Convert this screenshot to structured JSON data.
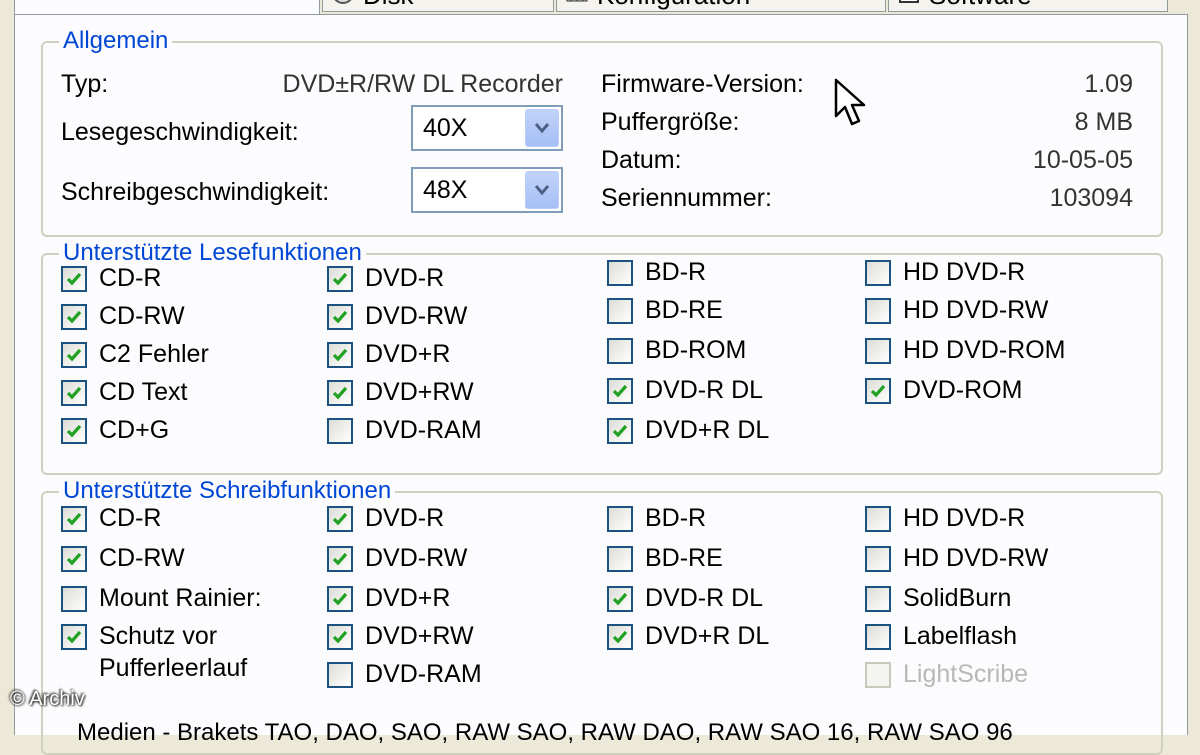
{
  "tabs": [
    {
      "label": "Disk",
      "icon": "disk-icon"
    },
    {
      "label": "Konfiguration",
      "icon": "configuration-icon"
    },
    {
      "label": "Software",
      "icon": "software-icon"
    }
  ],
  "allgemein": {
    "title": "Allgemein",
    "typ_label": "Typ:",
    "typ_value": "DVD±R/RW DL Recorder",
    "read_speed_label": "Lesegeschwindigkeit:",
    "read_speed_value": "40X",
    "write_speed_label": "Schreibgeschwindigkeit:",
    "write_speed_value": "48X",
    "firmware_label": "Firmware-Version:",
    "firmware_value": "1.09",
    "buffer_label": "Puffergröße:",
    "buffer_value": "8 MB",
    "date_label": "Datum:",
    "date_value": "10-05-05",
    "serial_label": "Seriennummer:",
    "serial_value": "103094"
  },
  "read_features": {
    "title": "Unterstützte Lesefunktionen",
    "columns": [
      [
        {
          "label": "CD-R",
          "checked": true
        },
        {
          "label": "CD-RW",
          "checked": true
        },
        {
          "label": "C2 Fehler",
          "checked": true
        },
        {
          "label": "CD Text",
          "checked": true
        },
        {
          "label": "CD+G",
          "checked": true
        }
      ],
      [
        {
          "label": "DVD-R",
          "checked": true
        },
        {
          "label": "DVD-RW",
          "checked": true
        },
        {
          "label": "DVD+R",
          "checked": true
        },
        {
          "label": "DVD+RW",
          "checked": true
        },
        {
          "label": "DVD-RAM",
          "checked": false
        }
      ],
      [
        {
          "label": "BD-R",
          "checked": false
        },
        {
          "label": "BD-RE",
          "checked": false
        },
        {
          "label": "BD-ROM",
          "checked": false
        },
        {
          "label": "DVD-R DL",
          "checked": true
        },
        {
          "label": "DVD+R DL",
          "checked": true
        }
      ],
      [
        {
          "label": "HD DVD-R",
          "checked": false
        },
        {
          "label": "HD DVD-RW",
          "checked": false
        },
        {
          "label": "HD DVD-ROM",
          "checked": false
        },
        {
          "label": "DVD-ROM",
          "checked": true
        }
      ]
    ]
  },
  "write_features": {
    "title": "Unterstützte Schreibfunktionen",
    "columns": [
      [
        {
          "label": "CD-R",
          "checked": true
        },
        {
          "label": "CD-RW",
          "checked": true
        },
        {
          "label": "Mount Rainier:",
          "checked": false
        },
        {
          "label": "Schutz vor",
          "label2": "Pufferleerlauf",
          "checked": true
        }
      ],
      [
        {
          "label": "DVD-R",
          "checked": true
        },
        {
          "label": "DVD-RW",
          "checked": true
        },
        {
          "label": "DVD+R",
          "checked": true
        },
        {
          "label": "DVD+RW",
          "checked": true
        },
        {
          "label": "DVD-RAM",
          "checked": false
        }
      ],
      [
        {
          "label": "BD-R",
          "checked": false
        },
        {
          "label": "BD-RE",
          "checked": false
        },
        {
          "label": "DVD-R DL",
          "checked": true
        },
        {
          "label": "DVD+R DL",
          "checked": true
        }
      ],
      [
        {
          "label": "HD DVD-R",
          "checked": false
        },
        {
          "label": "HD DVD-RW",
          "checked": false
        },
        {
          "label": "SolidBurn",
          "checked": false
        },
        {
          "label": "Labelflash",
          "checked": false
        },
        {
          "label": "LightScribe",
          "checked": false,
          "disabled": true
        }
      ]
    ]
  },
  "watermark": "© Archiv",
  "bottom_text": "Medien - Brakets TAO, DAO, SAO, RAW SAO, RAW DAO, RAW SAO 16, RAW SAO 96"
}
